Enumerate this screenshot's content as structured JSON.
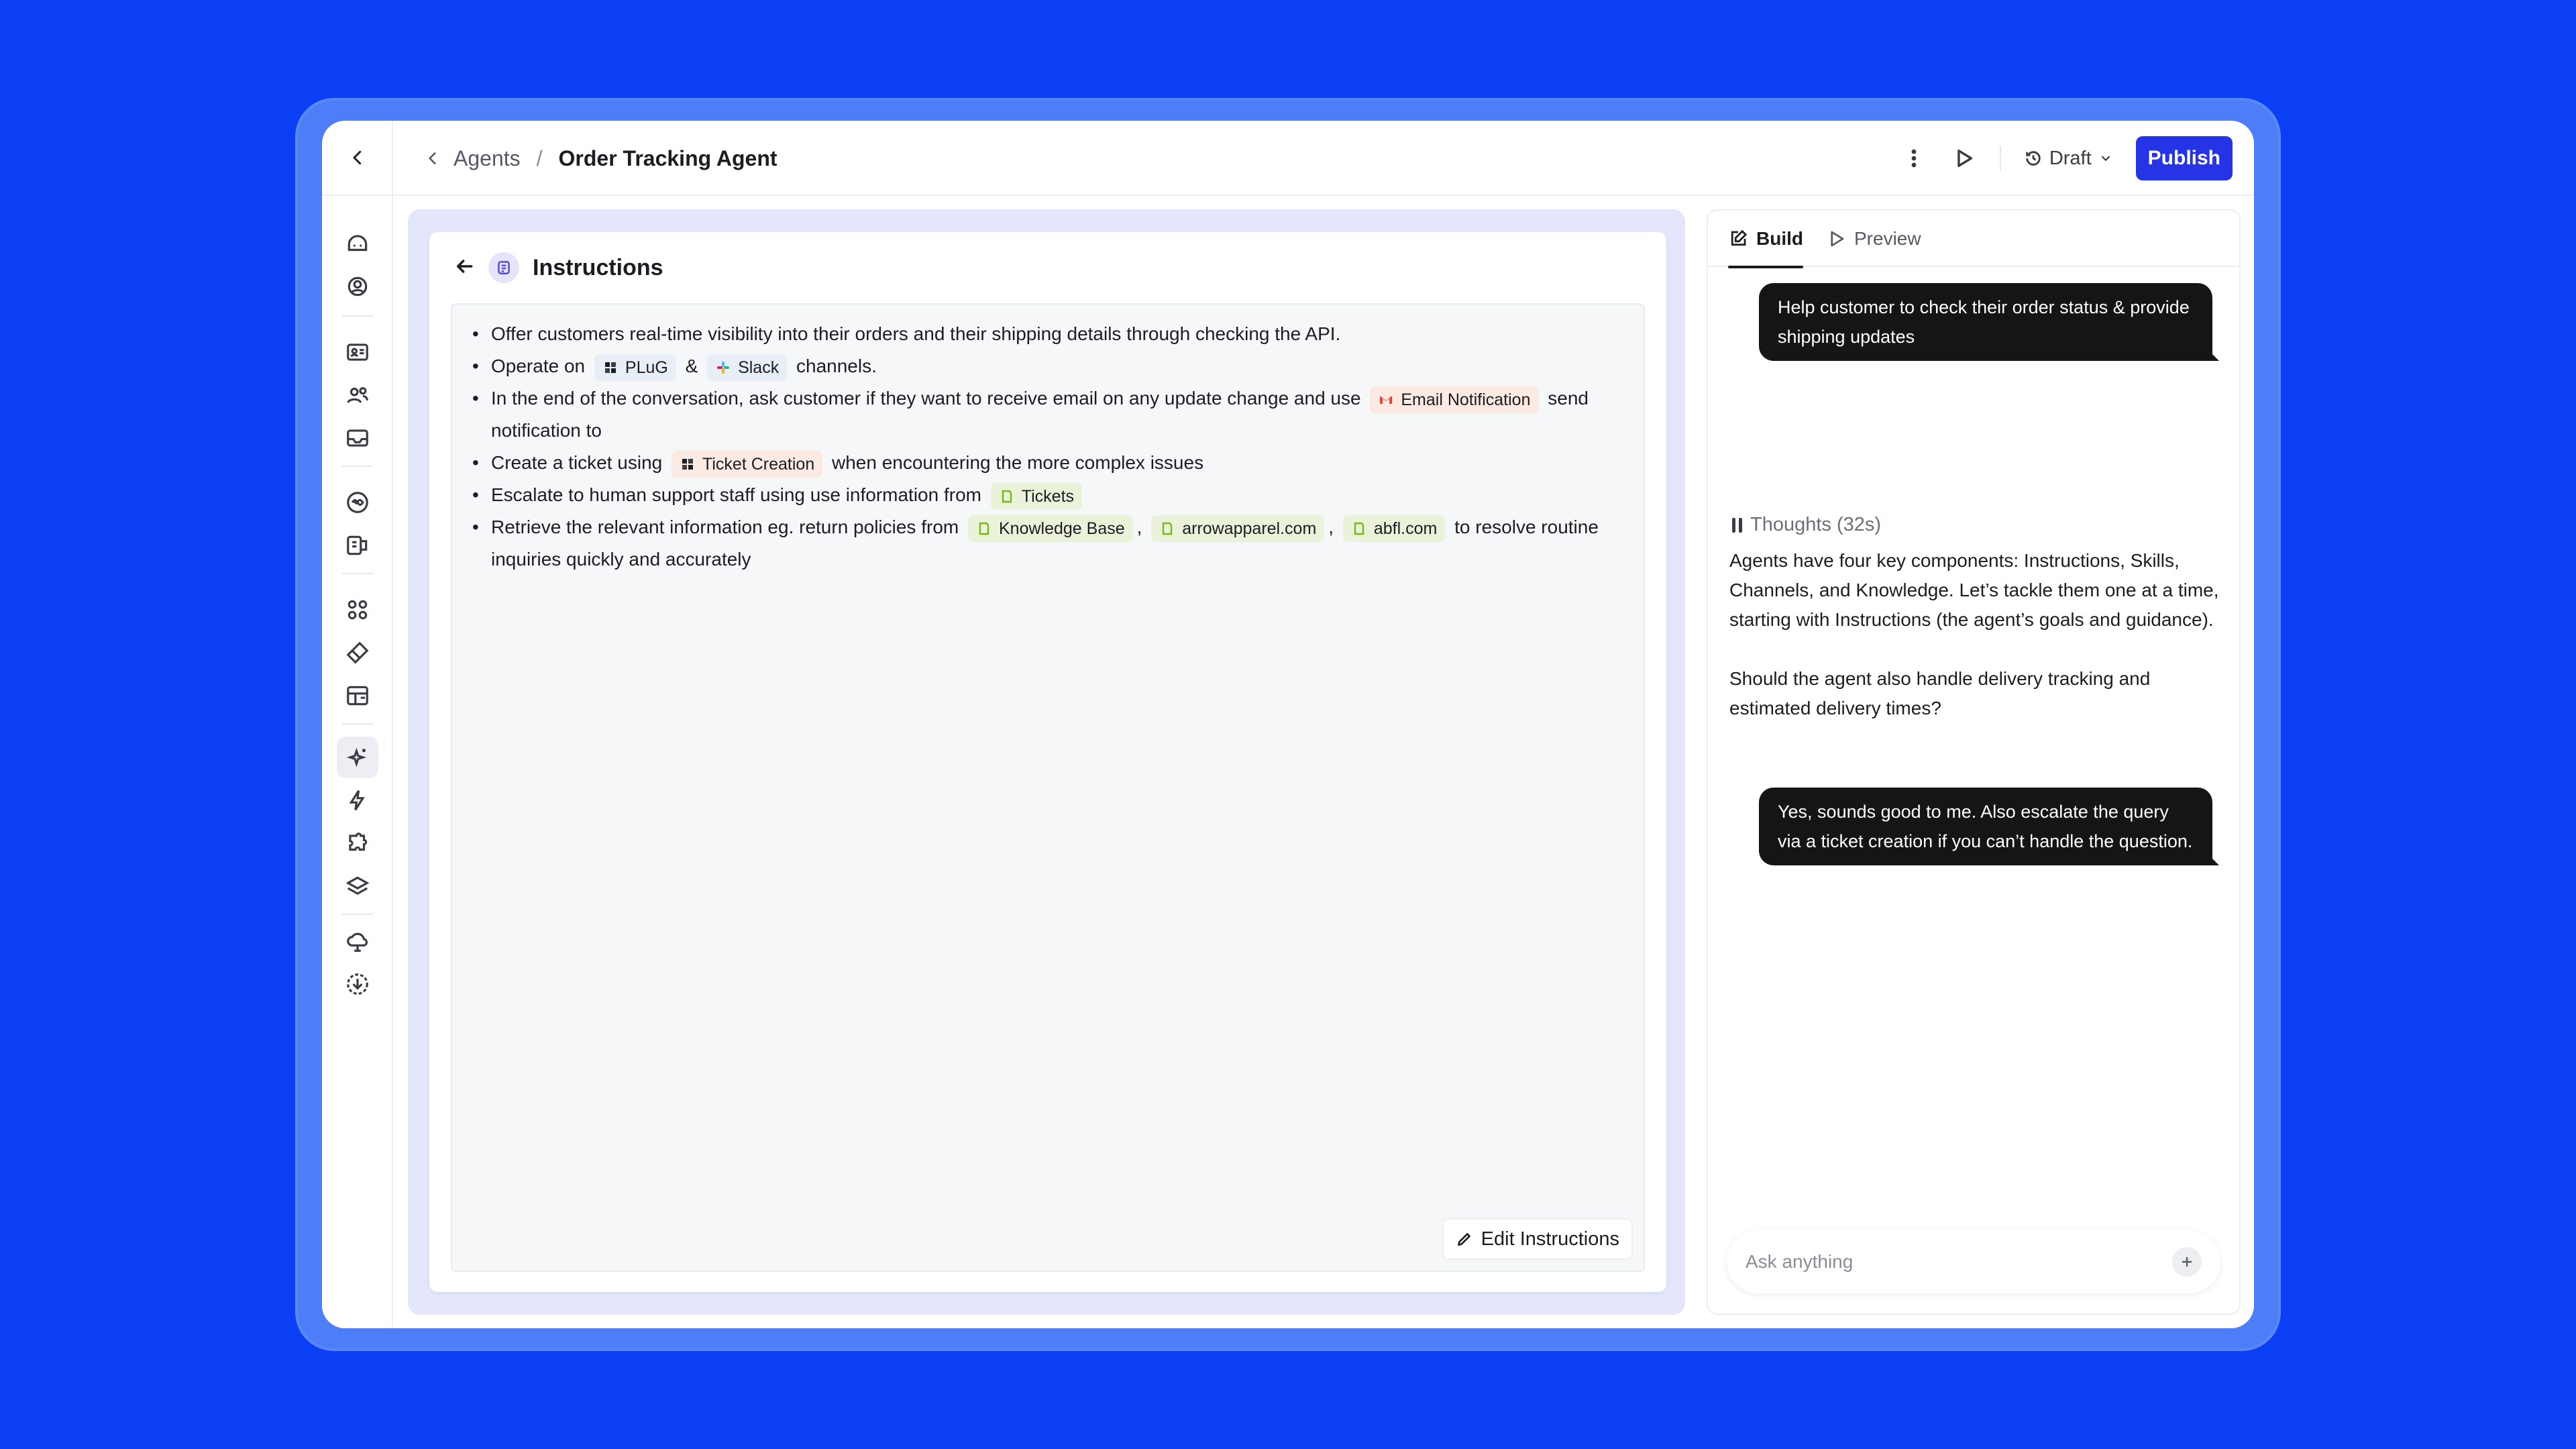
{
  "header": {
    "breadcrumb_parent": "Agents",
    "breadcrumb_separator": "/",
    "breadcrumb_current": "Order Tracking Agent",
    "status_label": "Draft",
    "publish_label": "Publish"
  },
  "instructions": {
    "title": "Instructions",
    "items": [
      {
        "text": "Offer customers real-time visibility into their orders and their shipping details through checking the API."
      },
      {
        "pre": "Operate on",
        "chip1": "PLuG",
        "mid": "&",
        "chip2": "Slack",
        "post": "channels."
      },
      {
        "pre": "In the end of the conversation, ask customer if they want to receive email on any update change and use",
        "chip": "Email Notification",
        "post": "send notification to"
      },
      {
        "pre": "Create a ticket using",
        "chip": "Ticket Creation",
        "post": "when encountering the more complex issues"
      },
      {
        "pre": "Escalate to human support staff using use information from",
        "chip": "Tickets"
      },
      {
        "pre": "Retrieve the relevant information eg. return policies from",
        "chip1": "Knowledge Base",
        "sep1": ",",
        "chip2": "arrowapparel.com",
        "sep2": ",",
        "chip3": "abfl.com",
        "post": "to resolve routine inquiries quickly and accurately"
      }
    ],
    "edit_label": "Edit Instructions"
  },
  "chat": {
    "tabs": [
      "Build",
      "Preview"
    ],
    "user_message_1": "Help customer to check their order status & provide shipping updates",
    "thoughts_label": "Thoughts (32s)",
    "assistant_paragraph_1": "Agents have four key components: Instructions, Skills, Channels, and Knowledge. Let’s tackle them one at a time, starting with Instructions (the agent’s goals and guidance).",
    "assistant_paragraph_2": "Should the agent also handle delivery tracking and estimated delivery times?",
    "user_message_2": "Yes, sounds good to me. Also escalate the query via a ticket creation if you can’t handle the question.",
    "input_placeholder": "Ask anything"
  },
  "colors": {
    "background": "#0a3ff4",
    "frame": "#4d7df7",
    "publish": "#2434e6",
    "center_panel": "#e4e6fb",
    "bubble": "#151515"
  },
  "icons": {
    "rail": [
      "home-icon",
      "support-icon",
      "contact-card-icon",
      "users-icon",
      "inbox-icon",
      "infinity-icon",
      "integrations-icon",
      "apps-icon",
      "tag-icon",
      "table-icon",
      "sparkle-icon",
      "lightning-icon",
      "puzzle-icon",
      "layers-icon",
      "cloud-icon",
      "download-icon"
    ]
  }
}
